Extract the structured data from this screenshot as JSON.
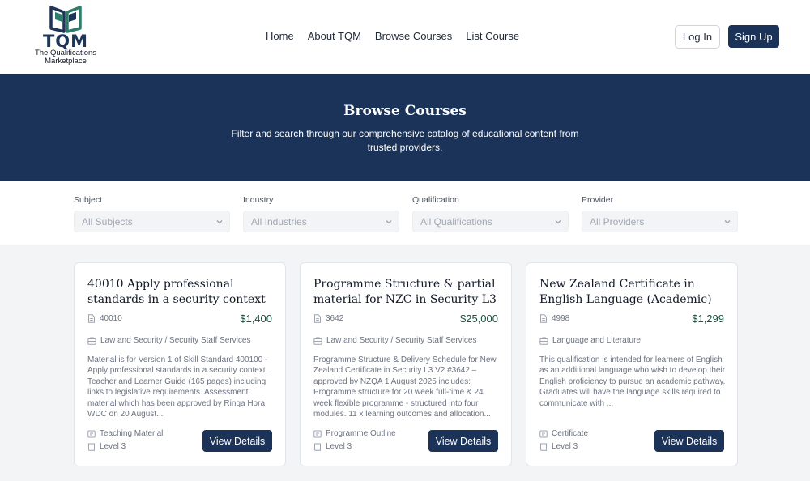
{
  "brand": {
    "name": "TQM",
    "tagline_line1": "The Qualifications",
    "tagline_line2": "Marketplace"
  },
  "nav": {
    "home": "Home",
    "about": "About TQM",
    "browse": "Browse Courses",
    "list": "List Course"
  },
  "auth": {
    "login": "Log In",
    "signup": "Sign Up"
  },
  "hero": {
    "title": "Browse Courses",
    "subtitle": "Filter and search through our comprehensive catalog of educational content from trusted providers."
  },
  "filters": {
    "subject": {
      "label": "Subject",
      "value": "All Subjects"
    },
    "industry": {
      "label": "Industry",
      "value": "All Industries"
    },
    "qualification": {
      "label": "Qualification",
      "value": "All Qualifications"
    },
    "provider": {
      "label": "Provider",
      "value": "All Providers"
    }
  },
  "courses": [
    {
      "title": "40010 Apply professional standards in a security context",
      "code": "40010",
      "price": "$1,400",
      "category": "Law and Security / Security Staff Services",
      "description": "Material is for Version 1 of Skill Standard 400100 - Apply professional standards in a security context. Teacher and Learner Guide (165 pages) including links to legislative requirements. Assessment material which has been approved by Ringa Hora WDC on 20 August...",
      "type": "Teaching Material",
      "level": "Level 3",
      "button": "View Details"
    },
    {
      "title": "Programme Structure & partial material for NZC in Security L3",
      "code": "3642",
      "price": "$25,000",
      "category": "Law and Security / Security Staff Services",
      "description": "Programme Structure & Delivery Schedule for New Zealand Certificate in Security L3 V2 #3642 – approved by NZQA 1 August 2025 includes: Programme structure for 20 week full-time & 24 week flexible programme - structured into four modules. 11 x learning outcomes and allocation...",
      "type": "Programme Outline",
      "level": "Level 3",
      "button": "View Details"
    },
    {
      "title": "New Zealand Certificate in English Language (Academic)",
      "code": "4998",
      "price": "$1,299",
      "category": "Language and Literature",
      "description": "This qualification is intended for learners of English as an additional language who wish to develop their English proficiency to pursue an academic pathway.\nGraduates will have the language skills required to communicate with ...",
      "type": "Certificate",
      "level": "Level 3",
      "button": "View Details"
    }
  ],
  "colors": {
    "navy": "#1b3358",
    "price_green": "#17523f",
    "logo_teal": "#2e7d6b"
  }
}
